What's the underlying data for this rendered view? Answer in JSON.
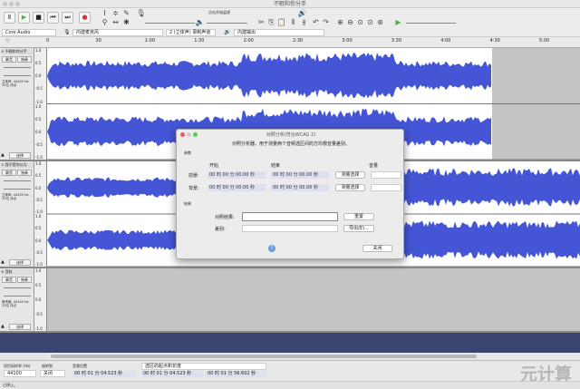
{
  "window": {
    "title": "不眠和你分手"
  },
  "toolbar": {
    "device_host": "Core Audio",
    "record_device": "内建麦克风",
    "channels": "2 (立体声) 录制声道",
    "playback_device": "内建输出",
    "meter_label": "点击开始监视"
  },
  "ruler": {
    "ticks": [
      "0",
      "30",
      "1:00",
      "1:30",
      "2:00",
      "2:30",
      "3:00",
      "3:30",
      "4:00",
      "4:30",
      "5:00"
    ]
  },
  "tracks": [
    {
      "name": "不眠和你分手",
      "mute": "静音",
      "solo": "独奏",
      "info": "立体声, 44100 Hz\n32位 浮点",
      "select": "选择",
      "scale": [
        "1.0",
        "0.5",
        "0.0",
        "-0.5",
        "-1.0"
      ]
    },
    {
      "name": "我不是你以为",
      "mute": "静音",
      "solo": "独奏",
      "info": "立体声, 44100 Hz\n32位 浮点",
      "select": "选择",
      "scale": [
        "1.0",
        "0.5",
        "0.0",
        "-0.5",
        "-1.0"
      ]
    },
    {
      "name": "音轨",
      "mute": "静音",
      "solo": "独奏",
      "info": "单声道, 44100 Hz\n32位 浮点",
      "select": "选择",
      "scale": [
        "1.0",
        "0.5",
        "0.0",
        "-0.5",
        "-1.0"
      ]
    }
  ],
  "dialog": {
    "title": "对照分析(符合WCAG 2)",
    "description": "对照分析器，用于测量两个音频选区间的方均根音量差别。",
    "params_label": "参数",
    "start_header": "开始",
    "end_header": "结束",
    "volume_header": "音量",
    "foreground_label": "前景:",
    "background_label": "背景:",
    "time_zero": "00 时 00 分 00.00 秒",
    "measure_button": "测量选择",
    "results_label": "结果",
    "contrast_label": "对照结果:",
    "reset_button": "重置",
    "diff_label": "差别:",
    "export_button": "导出(E)...",
    "help_icon": "?",
    "close_button": "关闭"
  },
  "selection": {
    "rate_label": "项目采样率 (Hz)",
    "snap_label": "吸附到",
    "rate_value": "44100",
    "snap_value": "关闭",
    "position_label": "音频位置",
    "sel_mode": "选区的起点和长度",
    "position_value": "00 时 01 分 04.523 秒",
    "start_value": "00 时 01 分 04.523 秒",
    "length_value": "00 时 01 分 56.602 秒"
  },
  "status": "已停止。",
  "watermark": "元计算",
  "colors": {
    "waveform": "#4455d6",
    "selection_bg": "#ffffff",
    "track_bg": "#c4c4c4"
  }
}
